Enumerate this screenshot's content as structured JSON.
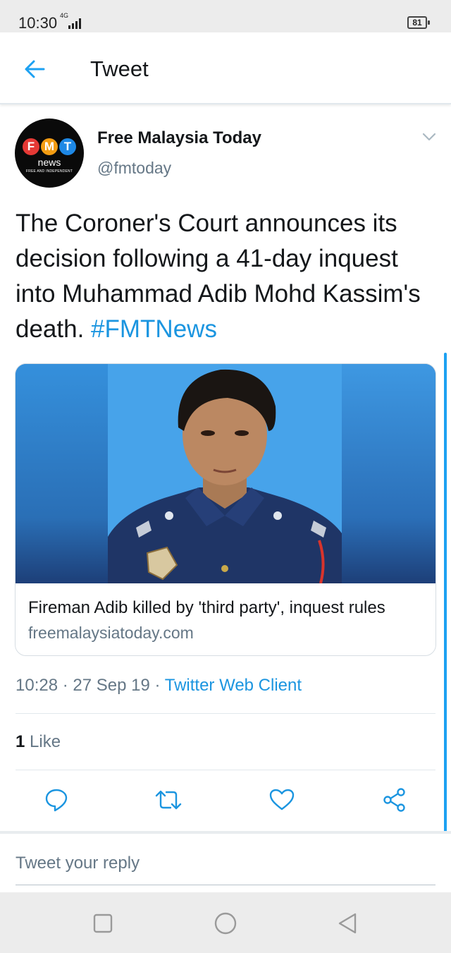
{
  "status_bar": {
    "time": "10:30",
    "network": "4G",
    "battery": "81"
  },
  "app_bar": {
    "title": "Tweet"
  },
  "tweet": {
    "author_name": "Free Malaysia Today",
    "author_handle": "@fmtoday",
    "avatar": {
      "letters": [
        "F",
        "M",
        "T"
      ],
      "letter_colors": [
        "#e53935",
        "#f39c12",
        "#1e88e5"
      ],
      "line1": "news",
      "line2": "FREE AND INDEPENDENT"
    },
    "text": "The Coroner's Court announces its decision following a 41-day inquest into Muhammad Adib Mohd Kassim's death.",
    "hashtag": "#FMTNews",
    "card": {
      "title": "Fireman Adib killed by 'third party', inquest rules",
      "domain": "freemalaysiatoday.com"
    },
    "time": "10:28",
    "date": "27 Sep 19",
    "client": "Twitter Web Client",
    "likes_count": "1",
    "likes_label": "Like"
  },
  "reply": {
    "placeholder": "Tweet your reply"
  },
  "colors": {
    "accent": "#1da1f2",
    "link": "#1b95e0",
    "secondary_text": "#657786"
  }
}
